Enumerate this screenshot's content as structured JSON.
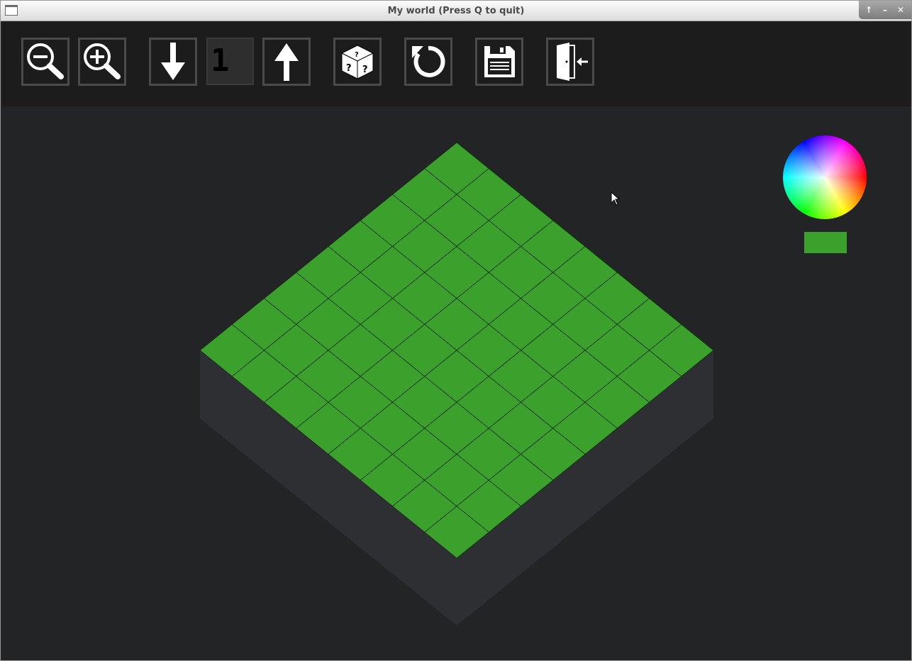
{
  "window": {
    "title": "My world (Press Q to quit)",
    "controls": {
      "maximize_label": "↑",
      "minimize_label": "–",
      "close_label": "✕"
    }
  },
  "toolbar": {
    "level_value": "1",
    "buttons": [
      {
        "name": "zoom-out-button",
        "icon": "zoom-out-icon"
      },
      {
        "name": "zoom-in-button",
        "icon": "zoom-in-icon"
      },
      {
        "name": "level-down-button",
        "icon": "arrow-down-icon"
      },
      {
        "name": "level-up-button",
        "icon": "arrow-up-icon"
      },
      {
        "name": "random-button",
        "icon": "dice-icon"
      },
      {
        "name": "reset-button",
        "icon": "reset-icon"
      },
      {
        "name": "save-button",
        "icon": "save-icon"
      },
      {
        "name": "exit-button",
        "icon": "exit-door-icon"
      }
    ]
  },
  "world": {
    "grid_size": 8,
    "tile_color": "#3ba02c",
    "side_color": "#2e2f33",
    "background_color": "#232426"
  },
  "palette": {
    "selected_color": "#3ba02c",
    "wheel_icon": "color-wheel-icon"
  }
}
